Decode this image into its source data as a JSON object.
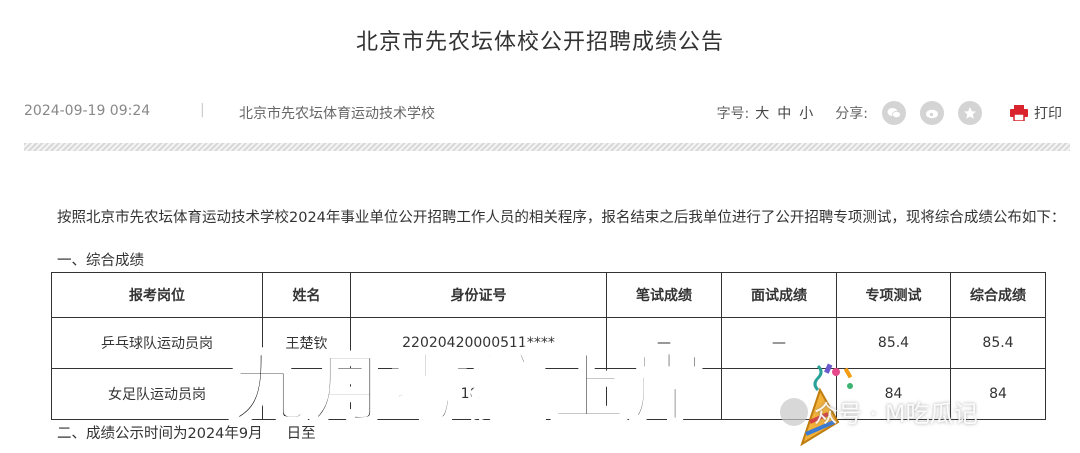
{
  "page": {
    "title": "北京市先农坛体校公开招聘成绩公告"
  },
  "meta": {
    "date": "2024-09-19 09:24",
    "separator": "|",
    "source": "北京市先农坛体育运动技术学校",
    "font_size_label": "字号:",
    "font_sizes": [
      "大",
      "中",
      "小"
    ],
    "share_label": "分享:",
    "share_icons": [
      "wechat-icon",
      "weibo-icon",
      "favorite-star-icon"
    ],
    "print_label": "打印"
  },
  "content": {
    "intro": "按照北京市先农坛体育运动技术学校2024年事业单位公开招聘工作人员的相关程序，报名结束之后我单位进行了公开招聘专项测试，现将综合成绩公布如下：",
    "section1": "一、综合成绩",
    "section2": "二、成绩公示时间为2024年9月",
    "section2_tail": "日至"
  },
  "table": {
    "headers": [
      "报考岗位",
      "姓名",
      "身份证号",
      "笔试成绩",
      "面试成绩",
      "专项测试",
      "综合成绩"
    ],
    "rows": [
      [
        "乒乓球队运动员岗",
        "王楚钦",
        "22020420000511****",
        "—",
        "—",
        "85.4",
        "85.4"
      ],
      [
        "女足队运动员岗",
        "",
        "1000",
        "",
        "",
        "84",
        "84"
      ]
    ]
  },
  "overlay": {
    "text": "九月考编上岸"
  },
  "watermark": {
    "text": "众号 · M吃瓜记"
  },
  "colors": {
    "accent_print": "#d9232d",
    "share_gray": "#d4d4d4",
    "text": "#333333"
  }
}
